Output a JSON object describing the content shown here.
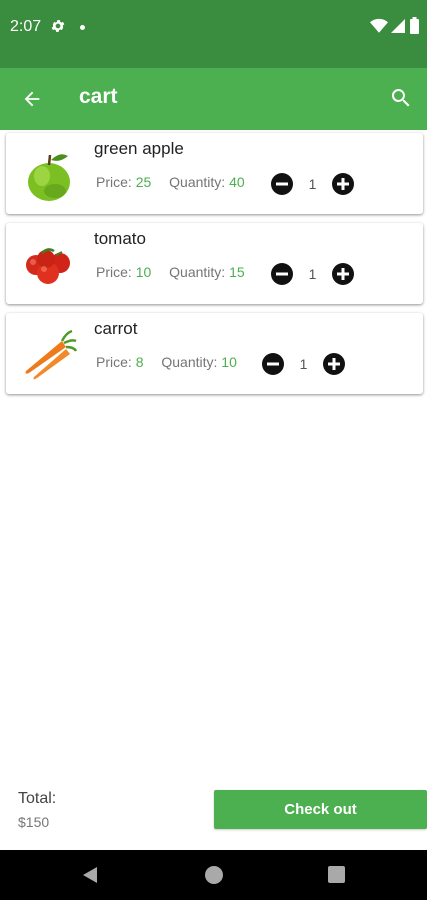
{
  "status_bar": {
    "time": "2:07",
    "icons": [
      "gear-icon",
      "dot-icon",
      "wifi-icon",
      "signal-icon",
      "battery-icon"
    ]
  },
  "app_bar": {
    "title": "cart",
    "back_icon": "arrow-back-icon",
    "search_icon": "search-icon",
    "color": "#4caf50"
  },
  "items": [
    {
      "name": "green apple",
      "price_label": "Price:",
      "price": "25",
      "quantity_label": "Quantity:",
      "quantity": "40",
      "count": "1",
      "thumb": "apple-icon"
    },
    {
      "name": "tomato",
      "price_label": "Price:",
      "price": "10",
      "quantity_label": "Quantity:",
      "quantity": "15",
      "count": "1",
      "thumb": "tomato-icon"
    },
    {
      "name": "carrot",
      "price_label": "Price:",
      "price": "8",
      "quantity_label": "Quantity:",
      "quantity": "10",
      "count": "1",
      "thumb": "carrot-icon"
    }
  ],
  "footer": {
    "total_label": "Total:",
    "total_value": "$150",
    "checkout_label": "Check out"
  },
  "colors": {
    "status_bar": "#3a8c3e",
    "accent": "#4caf50",
    "value_text": "#4caf50"
  }
}
